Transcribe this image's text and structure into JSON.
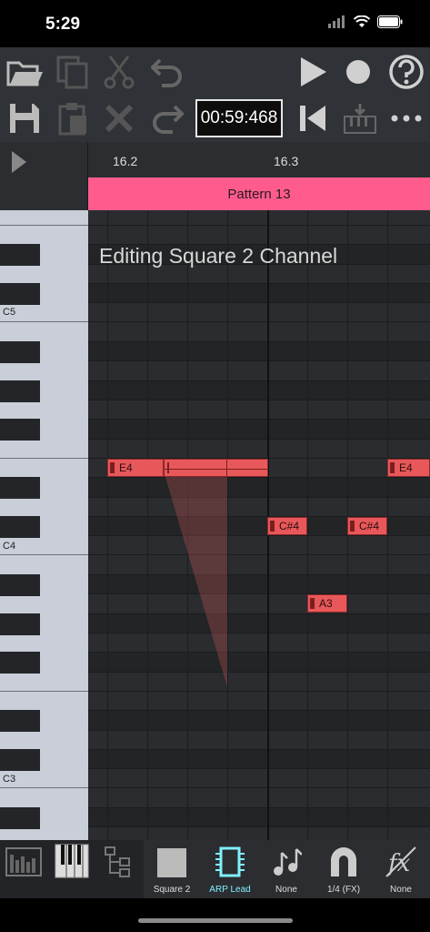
{
  "status": {
    "time": "5:29"
  },
  "toolbar": {
    "counter": "00:59:468"
  },
  "ruler": {
    "mark1": "16.2",
    "mark2": "16.3"
  },
  "pattern": {
    "name": "Pattern 13"
  },
  "grid": {
    "title": "Editing Square 2 Channel"
  },
  "keys": {
    "c5": "C5",
    "c4": "C4",
    "c3": "C3"
  },
  "notes": {
    "e4_a": "E4",
    "e4_b": "E4",
    "cs4_a": "C#4",
    "cs4_b": "C#4",
    "a3": "A3"
  },
  "bottom": {
    "instrument": "Square 2",
    "arp": "ARP Lead",
    "effect": "None",
    "snap": "1/4 (FX)",
    "fx": "None"
  },
  "colors": {
    "accent": "#ff5c8d",
    "note": "#e8585a",
    "arp_active": "#7ff0ff"
  }
}
